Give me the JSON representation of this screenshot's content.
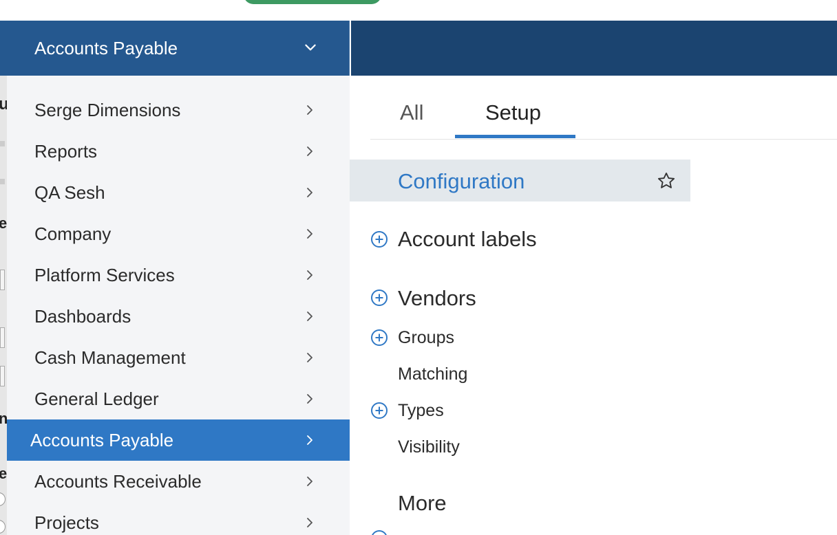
{
  "sidebar": {
    "header_title": "Accounts Payable",
    "items": [
      {
        "label": "Serge Dimensions"
      },
      {
        "label": "Reports"
      },
      {
        "label": "QA Sesh"
      },
      {
        "label": "Company"
      },
      {
        "label": "Platform Services"
      },
      {
        "label": "Dashboards"
      },
      {
        "label": "Cash Management"
      },
      {
        "label": "General Ledger"
      },
      {
        "label": "Accounts Payable",
        "active": true
      },
      {
        "label": "Accounts Receivable"
      },
      {
        "label": "Projects"
      }
    ]
  },
  "main": {
    "tabs": [
      {
        "label": "All"
      },
      {
        "label": "Setup",
        "selected": true
      }
    ],
    "configuration": {
      "label": "Configuration"
    },
    "sections": {
      "account_labels": "Account labels",
      "vendors": "Vendors",
      "groups": "Groups",
      "matching": "Matching",
      "types": "Types",
      "visibility": "Visibility",
      "more": "More"
    }
  },
  "background": {
    "peek_glyphs": [
      "u",
      "e",
      "n",
      "el"
    ]
  },
  "icons": {
    "header_chevron": "chevron-down-icon",
    "item_chevron": "chevron-right-icon",
    "star": "star-outline-icon",
    "expand": "plus-circle-icon"
  },
  "colors": {
    "sidebar_header": "#25588f",
    "header_band": "#1b4470",
    "active_item": "#2f78c5",
    "accent": "#2f78c5",
    "sidebar_bg": "#f4f5f7",
    "config_highlight": "#e3e8ec",
    "green_pill": "#3d9a62"
  }
}
